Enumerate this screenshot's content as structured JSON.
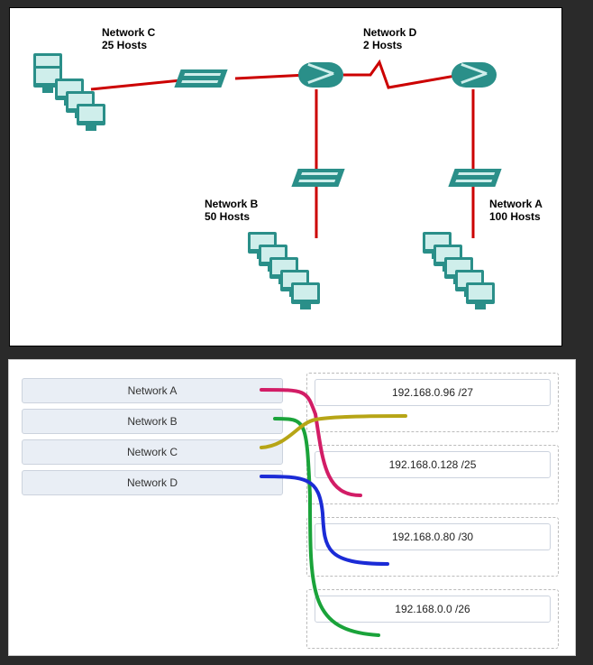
{
  "topology": {
    "networks": {
      "A": {
        "title": "Network A",
        "hosts": "100 Hosts"
      },
      "B": {
        "title": "Network B",
        "hosts": "50 Hosts"
      },
      "C": {
        "title": "Network C",
        "hosts": "25 Hosts"
      },
      "D": {
        "title": "Network D",
        "hosts": "2 Hosts"
      }
    }
  },
  "matching": {
    "left": [
      {
        "id": "netA",
        "label": "Network A"
      },
      {
        "id": "netB",
        "label": "Network B"
      },
      {
        "id": "netC",
        "label": "Network C"
      },
      {
        "id": "netD",
        "label": "Network D"
      }
    ],
    "right": [
      {
        "id": "s27",
        "label": "192.168.0.96 /27"
      },
      {
        "id": "s25",
        "label": "192.168.0.128 /25"
      },
      {
        "id": "s30",
        "label": "192.168.0.80 /30"
      },
      {
        "id": "s26",
        "label": "192.168.0.0 /26"
      }
    ],
    "connections": [
      {
        "from": "netA",
        "to": "s25",
        "color": "#d21d66"
      },
      {
        "from": "netB",
        "to": "s26",
        "color": "#1aa33a"
      },
      {
        "from": "netC",
        "to": "s27",
        "color": "#b7a516"
      },
      {
        "from": "netD",
        "to": "s30",
        "color": "#1b2bd6"
      }
    ]
  }
}
